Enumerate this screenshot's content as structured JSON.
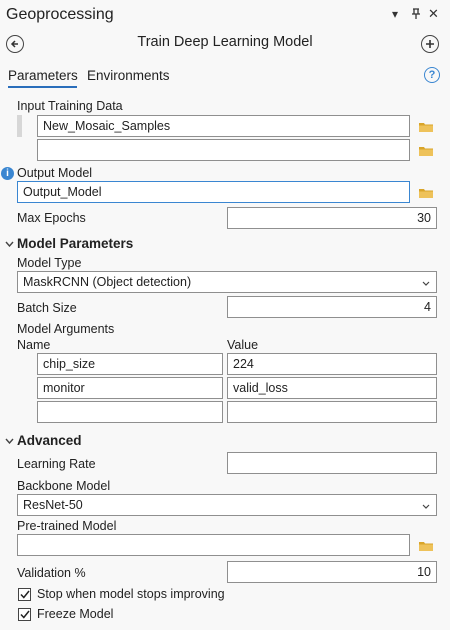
{
  "header": {
    "panel_title": "Geoprocessing",
    "dropdown_glyph": "▾",
    "pin_glyph": "⊥",
    "close_glyph": "✕",
    "tool_title": "Train Deep Learning Model"
  },
  "tabs": [
    {
      "label": "Parameters",
      "active": true
    },
    {
      "label": "Environments",
      "active": false
    }
  ],
  "help_glyph": "?",
  "colors": {
    "accent": "#3a86d1",
    "folder": "#d9a52a",
    "info": "#3a86d1"
  },
  "fields": {
    "input_training_data": {
      "label": "Input Training Data",
      "values": [
        "New_Mosaic_Samples",
        ""
      ]
    },
    "output_model": {
      "label": "Output Model",
      "value": "Output_Model"
    },
    "max_epochs": {
      "label": "Max Epochs",
      "value": "30"
    }
  },
  "model_parameters": {
    "section_label": "Model Parameters",
    "model_type_label": "Model Type",
    "model_type_value": "MaskRCNN (Object detection)",
    "batch_size_label": "Batch Size",
    "batch_size_value": "4",
    "model_arguments_label": "Model Arguments",
    "col_name": "Name",
    "col_value": "Value",
    "rows": [
      {
        "name": "chip_size",
        "value": "224"
      },
      {
        "name": "monitor",
        "value": "valid_loss"
      },
      {
        "name": "",
        "value": ""
      }
    ]
  },
  "advanced": {
    "section_label": "Advanced",
    "learning_rate_label": "Learning Rate",
    "learning_rate_value": "",
    "backbone_label": "Backbone Model",
    "backbone_value": "ResNet-50",
    "pretrained_label": "Pre-trained Model",
    "pretrained_value": "",
    "validation_label": "Validation %",
    "validation_value": "10",
    "stop_label": "Stop when model stops improving",
    "stop_checked": true,
    "freeze_label": "Freeze Model",
    "freeze_checked": true
  }
}
